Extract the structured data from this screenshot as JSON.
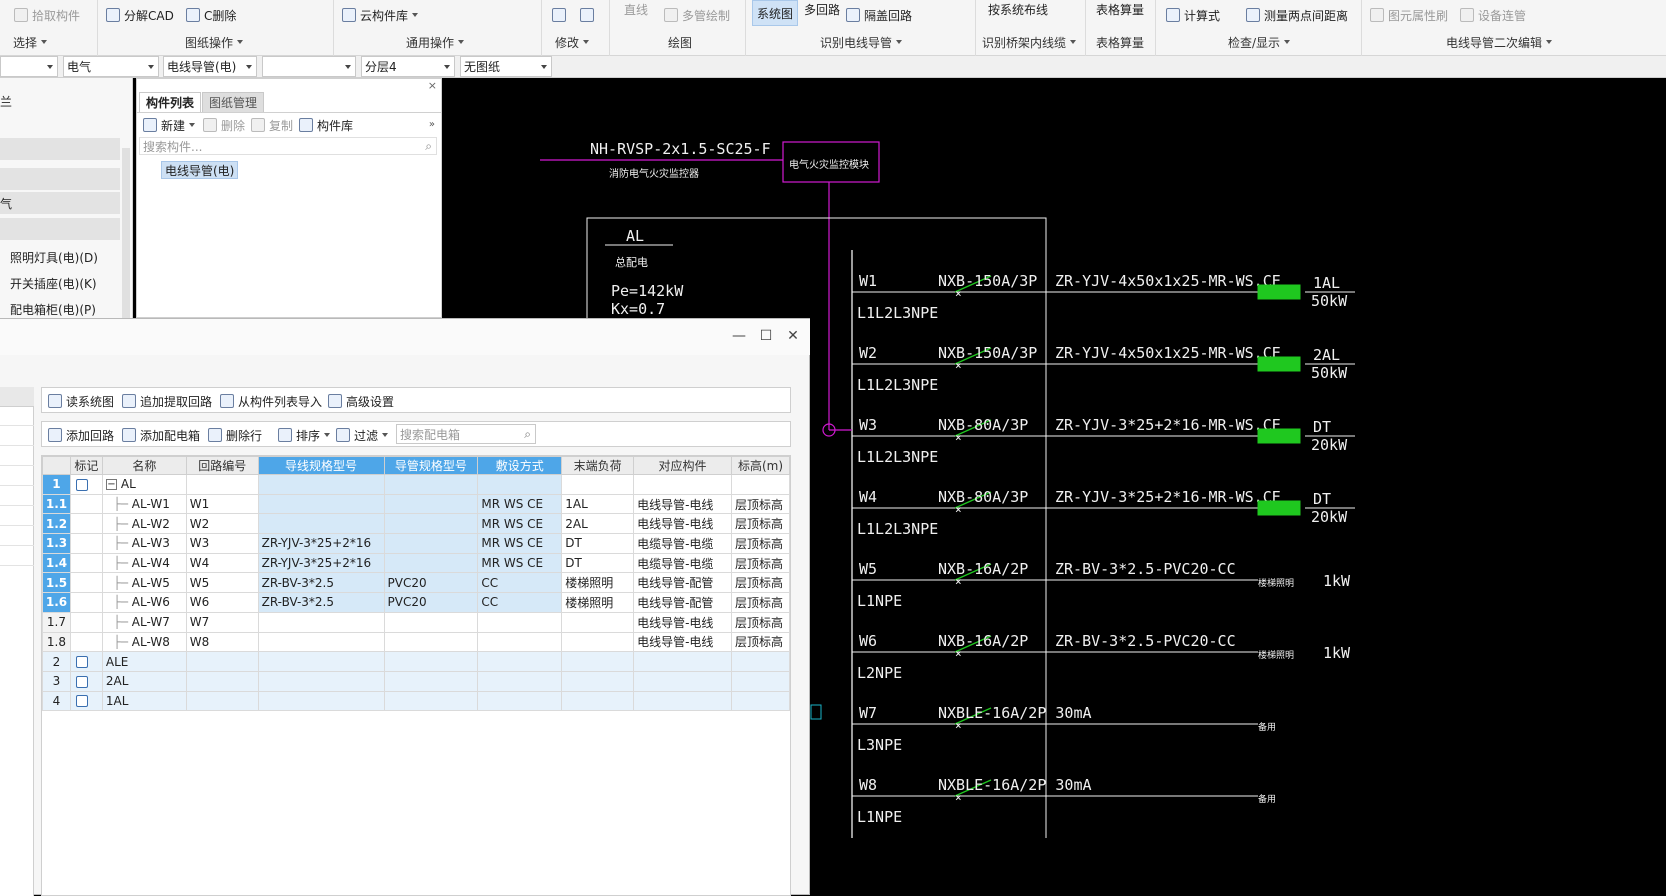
{
  "ribbon": {
    "pick_component": "拾取构件",
    "select": "选择",
    "decompose_cad": "分解CAD",
    "delete_c": "C删除",
    "drawing_ops": "图纸操作",
    "cloud_lib": "云构件库",
    "common_ops": "通用操作",
    "modify": "修改",
    "straight": "直线",
    "multi_pipe": "多管绘制",
    "draw": "绘图",
    "system_diagram": "系统图",
    "multi_loop": "多回路",
    "cover_loop": "隔盖回路",
    "identify_conduit": "识别电线导管",
    "by_system_layout": "按系统布线",
    "identify_bridge": "识别桥架内线缆",
    "table_calc": "表格算量",
    "table_calc2": "表格算量",
    "formula": "计算式",
    "measure": "测量两点间距离",
    "check_show": "检查/显示",
    "brush_attr": "图元属性刷",
    "equip_link": "设备连管",
    "secondary_edit": "电线导管二次编辑"
  },
  "combos": {
    "c1": "",
    "c2": "电气",
    "c3": "电线导管(电)",
    "c4": "",
    "c5": "分层4",
    "c6": "无图纸"
  },
  "left_pane": {
    "items": [
      "照明灯具(电)(D)",
      "开关插座(电)(K)",
      "配电箱柜(电)(P)"
    ],
    "fragment1": "兰",
    "fragment2": "气"
  },
  "comp_list": {
    "tab_list": "构件列表",
    "tab_drawings": "图纸管理",
    "new": "新建",
    "delete": "删除",
    "copy": "复制",
    "library": "构件库",
    "search_placeholder": "搜索构件...",
    "node": "电线导管(电)"
  },
  "dialog": {
    "toolbar1": {
      "read_system": "读系统图",
      "append_loop": "追加提取回路",
      "import_list": "从构件列表导入",
      "advanced": "高级设置"
    },
    "toolbar2": {
      "add_loop": "添加回路",
      "add_box": "添加配电箱",
      "delete_row": "删除行",
      "sort": "排序",
      "filter": "过滤",
      "search_placeholder": "搜索配电箱"
    },
    "columns": [
      "",
      "标记",
      "名称",
      "回路编号",
      "导线规格型号",
      "导管规格型号",
      "敷设方式",
      "末端负荷",
      "对应构件",
      "标高(m)"
    ],
    "rows": [
      {
        "no": "1",
        "name": "AL",
        "loop": "",
        "wire": "",
        "pipe": "",
        "lay": "",
        "load": "",
        "comp": "",
        "elev": ""
      },
      {
        "no": "1.1",
        "name": "AL-W1",
        "loop": "W1",
        "wire": "",
        "pipe": "",
        "lay": "MR WS CE",
        "load": "1AL",
        "comp": "电线导管-电线",
        "elev": "层顶标高"
      },
      {
        "no": "1.2",
        "name": "AL-W2",
        "loop": "W2",
        "wire": "",
        "pipe": "",
        "lay": "MR WS CE",
        "load": "2AL",
        "comp": "电线导管-电线",
        "elev": "层顶标高"
      },
      {
        "no": "1.3",
        "name": "AL-W3",
        "loop": "W3",
        "wire": "ZR-YJV-3*25+2*16",
        "pipe": "",
        "lay": "MR WS CE",
        "load": "DT",
        "comp": "电缆导管-电缆",
        "elev": "层顶标高"
      },
      {
        "no": "1.4",
        "name": "AL-W4",
        "loop": "W4",
        "wire": "ZR-YJV-3*25+2*16",
        "pipe": "",
        "lay": "MR WS CE",
        "load": "DT",
        "comp": "电缆导管-电缆",
        "elev": "层顶标高"
      },
      {
        "no": "1.5",
        "name": "AL-W5",
        "loop": "W5",
        "wire": "ZR-BV-3*2.5",
        "pipe": "PVC20",
        "lay": "CC",
        "load": "楼梯照明",
        "comp": "电线导管-配管",
        "elev": "层顶标高"
      },
      {
        "no": "1.6",
        "name": "AL-W6",
        "loop": "W6",
        "wire": "ZR-BV-3*2.5",
        "pipe": "PVC20",
        "lay": "CC",
        "load": "楼梯照明",
        "comp": "电线导管-配管",
        "elev": "层顶标高"
      },
      {
        "no": "1.7",
        "name": "AL-W7",
        "loop": "W7",
        "wire": "",
        "pipe": "",
        "lay": "",
        "load": "",
        "comp": "电线导管-电线",
        "elev": "层顶标高"
      },
      {
        "no": "1.8",
        "name": "AL-W8",
        "loop": "W8",
        "wire": "",
        "pipe": "",
        "lay": "",
        "load": "",
        "comp": "电线导管-电线",
        "elev": "层顶标高"
      },
      {
        "no": "2",
        "name": "ALE",
        "loop": "",
        "wire": "",
        "pipe": "",
        "lay": "",
        "load": "",
        "comp": "",
        "elev": ""
      },
      {
        "no": "3",
        "name": "2AL",
        "loop": "",
        "wire": "",
        "pipe": "",
        "lay": "",
        "load": "",
        "comp": "",
        "elev": ""
      },
      {
        "no": "4",
        "name": "1AL",
        "loop": "",
        "wire": "",
        "pipe": "",
        "lay": "",
        "load": "",
        "comp": "",
        "elev": ""
      }
    ]
  },
  "cad": {
    "feeder": "NH-RVSP-2x1.5-SC25-F",
    "feeder_sub": "消防电气火灾监控器",
    "monitor_box": "电气火灾监控模块",
    "panel": "AL",
    "panel_sub": "总配电",
    "pe": "Pe=142kW",
    "kx": "Kx=0.7",
    "circuits": [
      {
        "w": "W1",
        "breaker": "NXB-150A/3P",
        "phase": "L1L2L3NPE",
        "cable": "ZR-YJV-4x50x1x25-MR-WS.CE",
        "load": "1AL",
        "kw": "50kW"
      },
      {
        "w": "W2",
        "breaker": "NXB-150A/3P",
        "phase": "L1L2L3NPE",
        "cable": "ZR-YJV-4x50x1x25-MR-WS.CE",
        "load": "2AL",
        "kw": "50kW"
      },
      {
        "w": "W3",
        "breaker": "NXB-80A/3P",
        "phase": "L1L2L3NPE",
        "cable": "ZR-YJV-3*25+2*16-MR-WS.CE",
        "load": "DT",
        "kw": "20kW"
      },
      {
        "w": "W4",
        "breaker": "NXB-80A/3P",
        "phase": "L1L2L3NPE",
        "cable": "ZR-YJV-3*25+2*16-MR-WS.CE",
        "load": "DT",
        "kw": "20kW"
      },
      {
        "w": "W5",
        "breaker": "NXB-16A/2P",
        "phase": "L1NPE",
        "cable": "ZR-BV-3*2.5-PVC20-CC",
        "load": "楼梯照明",
        "kw": "1kW"
      },
      {
        "w": "W6",
        "breaker": "NXB-16A/2P",
        "phase": "L2NPE",
        "cable": "ZR-BV-3*2.5-PVC20-CC",
        "load": "楼梯照明",
        "kw": "1kW"
      },
      {
        "w": "W7",
        "breaker": "NXBLE-16A/2P 30mA",
        "phase": "L3NPE",
        "cable": "",
        "load": "备用",
        "kw": ""
      },
      {
        "w": "W8",
        "breaker": "NXBLE-16A/2P 30mA",
        "phase": "L1NPE",
        "cable": "",
        "load": "备用",
        "kw": ""
      }
    ],
    "colors": {
      "line": "#f0f0f0",
      "magenta": "#d21ad2",
      "green": "#1fc81f",
      "cyan": "#1ab4c8"
    }
  }
}
